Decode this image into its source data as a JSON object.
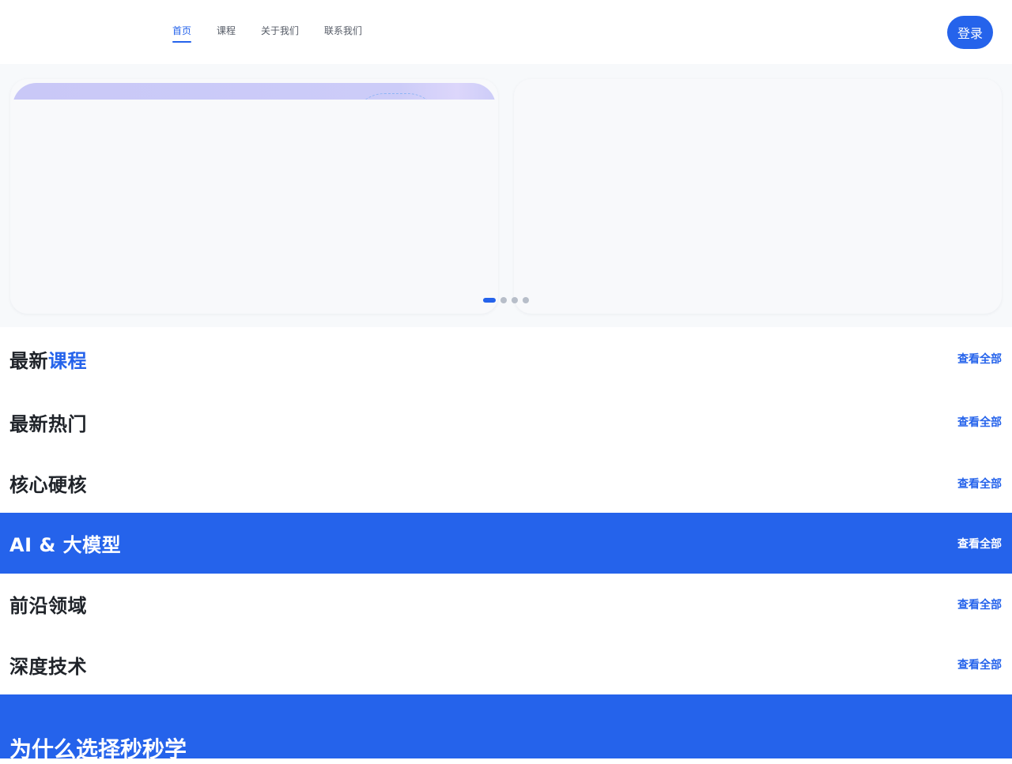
{
  "header": {
    "nav": [
      {
        "label": "首页",
        "active": true
      },
      {
        "label": "课程",
        "active": false
      },
      {
        "label": "关于我们",
        "active": false
      },
      {
        "label": "联系我们",
        "active": false
      }
    ],
    "login_label": "登录"
  },
  "carousel": {
    "slide_count": 4,
    "active_index": 0
  },
  "sections": {
    "latest_courses": {
      "title_part1": "最新",
      "title_part2": "课程",
      "view_all": "查看全部"
    },
    "hot": {
      "title": "最新热门",
      "view_all": "查看全部"
    },
    "core": {
      "title": "核心硬核",
      "view_all": "查看全部"
    },
    "ai": {
      "title": "AI & 大模型",
      "view_all": "查看全部"
    },
    "frontier": {
      "title": "前沿领域",
      "view_all": "查看全部"
    },
    "deep": {
      "title": "深度技术",
      "view_all": "查看全部"
    }
  },
  "why": {
    "title": "为什么选择秒秒学"
  },
  "colors": {
    "accent": "#2563eb",
    "text": "#1f2329",
    "banner_bg": "#f7f9fb"
  }
}
